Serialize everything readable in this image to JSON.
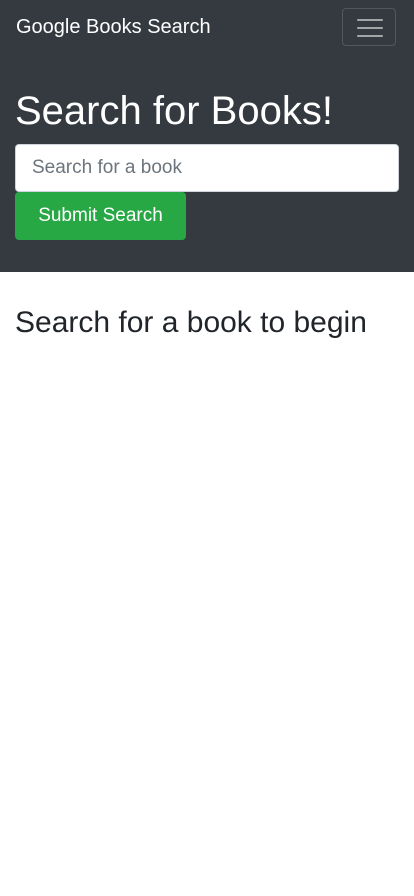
{
  "navbar": {
    "brand": "Google Books Search",
    "toggler_icon": "hamburger-menu-icon"
  },
  "hero": {
    "heading": "Search for Books!",
    "search": {
      "placeholder": "Search for a book",
      "value": ""
    },
    "submit_label": "Submit Search"
  },
  "results": {
    "empty_message": "Search for a book to begin"
  },
  "colors": {
    "header_background": "#343a40",
    "submit_button": "#28a745",
    "page_background": "#ffffff"
  }
}
